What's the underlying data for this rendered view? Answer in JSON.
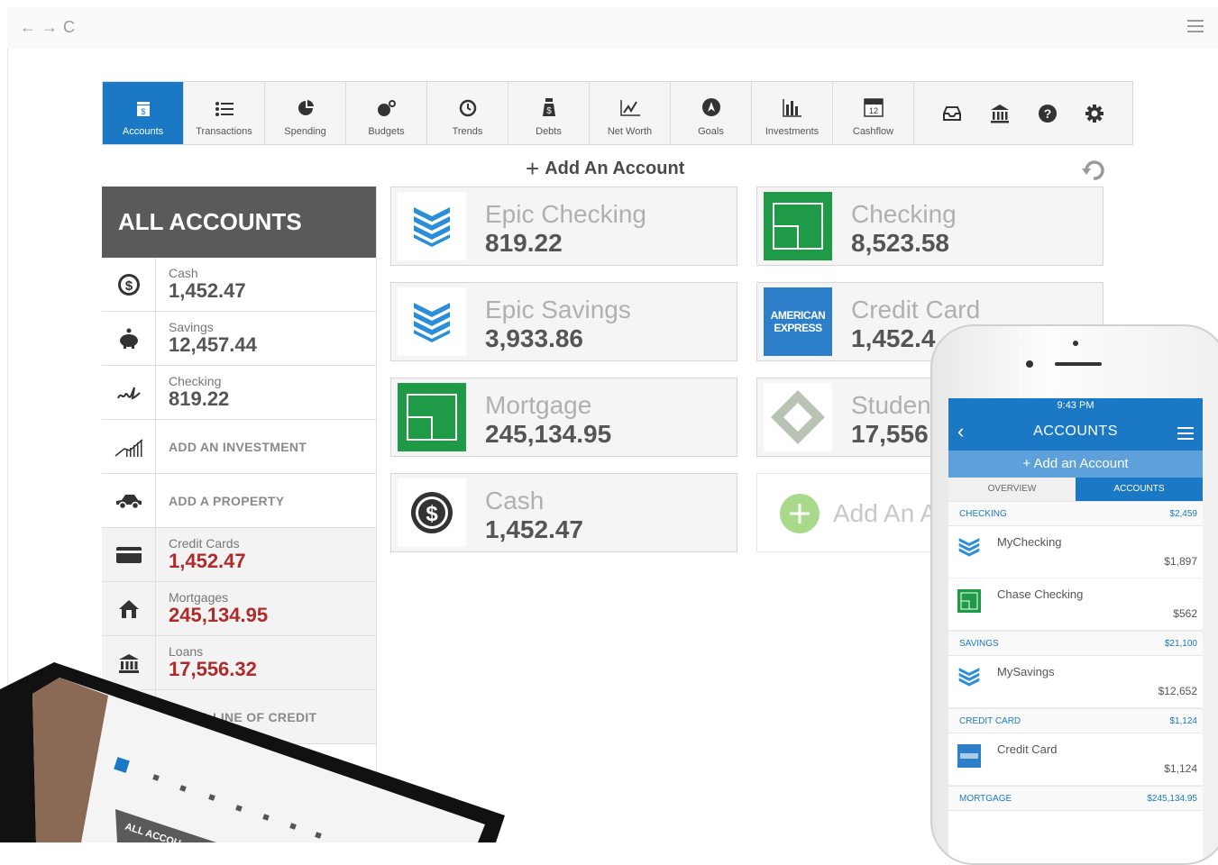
{
  "toolbar": {
    "items": [
      {
        "label": "Accounts",
        "icon": "accounts-icon"
      },
      {
        "label": "Transactions",
        "icon": "list-icon"
      },
      {
        "label": "Spending",
        "icon": "pie-icon"
      },
      {
        "label": "Budgets",
        "icon": "budgets-icon"
      },
      {
        "label": "Trends",
        "icon": "clock-icon"
      },
      {
        "label": "Debts",
        "icon": "money-bag-icon"
      },
      {
        "label": "Net Worth",
        "icon": "line-chart-icon"
      },
      {
        "label": "Goals",
        "icon": "compass-icon"
      },
      {
        "label": "Investments",
        "icon": "bar-chart-icon"
      },
      {
        "label": "Cashflow",
        "icon": "calendar-icon"
      }
    ],
    "calendar_day": "12"
  },
  "add_account_label": "Add An Account",
  "sidebar": {
    "title": "ALL ACCOUNTS",
    "rows": [
      {
        "label": "Cash",
        "value": "1,452.47"
      },
      {
        "label": "Savings",
        "value": "12,457.44"
      },
      {
        "label": "Checking",
        "value": "819.22"
      },
      {
        "action": "ADD AN INVESTMENT"
      },
      {
        "action": "ADD A PROPERTY"
      },
      {
        "label": "Credit Cards",
        "value": "1,452.47"
      },
      {
        "label": "Mortgages",
        "value": "245,134.95"
      },
      {
        "label": "Loans",
        "value": "17,556.32"
      },
      {
        "action": "ADD A LINE OF CREDIT"
      }
    ]
  },
  "cards": [
    {
      "name": "Epic Checking",
      "value": "819.22"
    },
    {
      "name": "Checking",
      "value": "8,523.58"
    },
    {
      "name": "Epic Savings",
      "value": "3,933.86"
    },
    {
      "name": "Credit Card",
      "value": "1,452.4"
    },
    {
      "name": "Mortgage",
      "value": "245,134.95"
    },
    {
      "name": "Studen",
      "value": "17,556"
    },
    {
      "name": "Cash",
      "value": "1,452.47"
    },
    {
      "name": "Add An A"
    }
  ],
  "amex_text": [
    "AMERICAN",
    "EXPRESS"
  ],
  "phone": {
    "time": "9:43 PM",
    "title": "ACCOUNTS",
    "add_label": "+ Add an Account",
    "tabs": [
      "OVERVIEW",
      "ACCOUNTS"
    ],
    "sections": [
      {
        "name": "CHECKING",
        "total": "$2,459"
      },
      {
        "name": "SAVINGS",
        "total": "$21,100"
      },
      {
        "name": "CREDIT CARD",
        "total": "$1,124"
      },
      {
        "name": "MORTGAGE",
        "total": "$245,134.95"
      }
    ],
    "items": [
      {
        "name": "MyChecking",
        "value": "$1,897"
      },
      {
        "name": "Chase Checking",
        "value": "$562"
      },
      {
        "name": "MySavings",
        "value": "$12,652"
      },
      {
        "name": "Credit Card",
        "value": "$1,124"
      }
    ]
  },
  "laptop": {
    "title": "ALL ACCOU"
  },
  "colors": {
    "accent": "#1b78c5",
    "negative": "#b02a2a",
    "green": "#1f9a46"
  }
}
